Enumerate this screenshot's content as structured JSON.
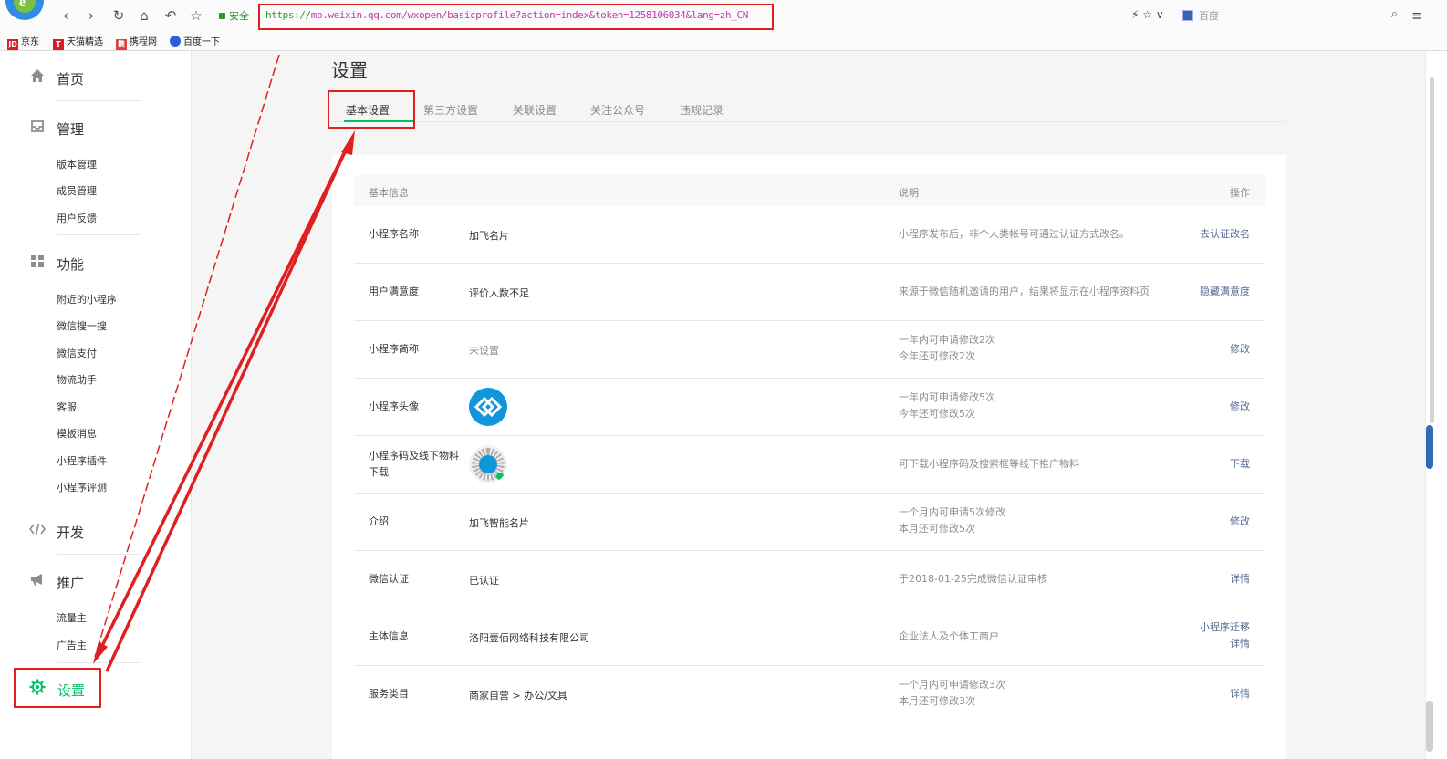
{
  "browser": {
    "secure_label": "安全",
    "url_scheme": "https://",
    "url_rest": "mp.weixin.qq.com/wxopen/basicprofile?action=index&token=1258106034&lang=zh_CN",
    "search_placeholder": "百度",
    "bookmarks": [
      "京东",
      "天猫精选",
      "携程网",
      "百度一下"
    ]
  },
  "sidebar": {
    "home": "首页",
    "manage": "管理",
    "manage_items": [
      "版本管理",
      "成员管理",
      "用户反馈"
    ],
    "features": "功能",
    "feature_items": [
      "附近的小程序",
      "微信搜一搜",
      "微信支付",
      "物流助手",
      "客服",
      "模板消息",
      "小程序插件",
      "小程序评测"
    ],
    "develop": "开发",
    "promote": "推广",
    "promote_items": [
      "流量主",
      "广告主"
    ],
    "settings": "设置"
  },
  "main": {
    "title": "设置",
    "tabs": [
      "基本设置",
      "第三方设置",
      "关联设置",
      "关注公众号",
      "违规记录"
    ],
    "table": {
      "headers": [
        "基本信息",
        "说明",
        "操作"
      ],
      "rows": [
        {
          "name": "小程序名称",
          "value": "加飞名片",
          "desc": [
            "小程序发布后，非个人类帐号可通过认证方式改名。"
          ],
          "ops": [
            "去认证改名"
          ]
        },
        {
          "name": "用户满意度",
          "value": "评价人数不足",
          "desc": [
            "来源于微信随机邀请的用户，结果将显示在小程序资料页"
          ],
          "ops": [
            "隐藏满意度"
          ]
        },
        {
          "name": "小程序简称",
          "value": "未设置",
          "desc": [
            "一年内可申请修改2次",
            "今年还可修改2次"
          ],
          "ops": [
            "修改"
          ]
        },
        {
          "name": "小程序头像",
          "value": "",
          "desc": [
            "一年内可申请修改5次",
            "今年还可修改5次"
          ],
          "ops": [
            "修改"
          ]
        },
        {
          "name": "小程序码及线下物料下载",
          "value": "",
          "desc": [
            "可下载小程序码及搜索框等线下推广物料"
          ],
          "ops": [
            "下载"
          ]
        },
        {
          "name": "介绍",
          "value": "加飞智能名片",
          "desc": [
            "一个月内可申请5次修改",
            "本月还可修改5次"
          ],
          "ops": [
            "修改"
          ]
        },
        {
          "name": "微信认证",
          "value": "已认证",
          "desc": [
            "于2018-01-25完成微信认证审核"
          ],
          "ops": [
            "详情"
          ]
        },
        {
          "name": "主体信息",
          "value": "洛阳壹佰网络科技有限公司",
          "desc": [
            "企业法人及个体工商户"
          ],
          "ops": [
            "小程序迁移",
            "详情"
          ]
        },
        {
          "name": "服务类目",
          "value": "商家自营 > 办公/文具",
          "desc": [
            "一个月内可申请修改3次",
            "本月还可修改3次"
          ],
          "ops": [
            "详情"
          ]
        }
      ]
    }
  },
  "colors": {
    "accent": "#07c160",
    "link": "#576b95",
    "highlight": "#e02020"
  }
}
